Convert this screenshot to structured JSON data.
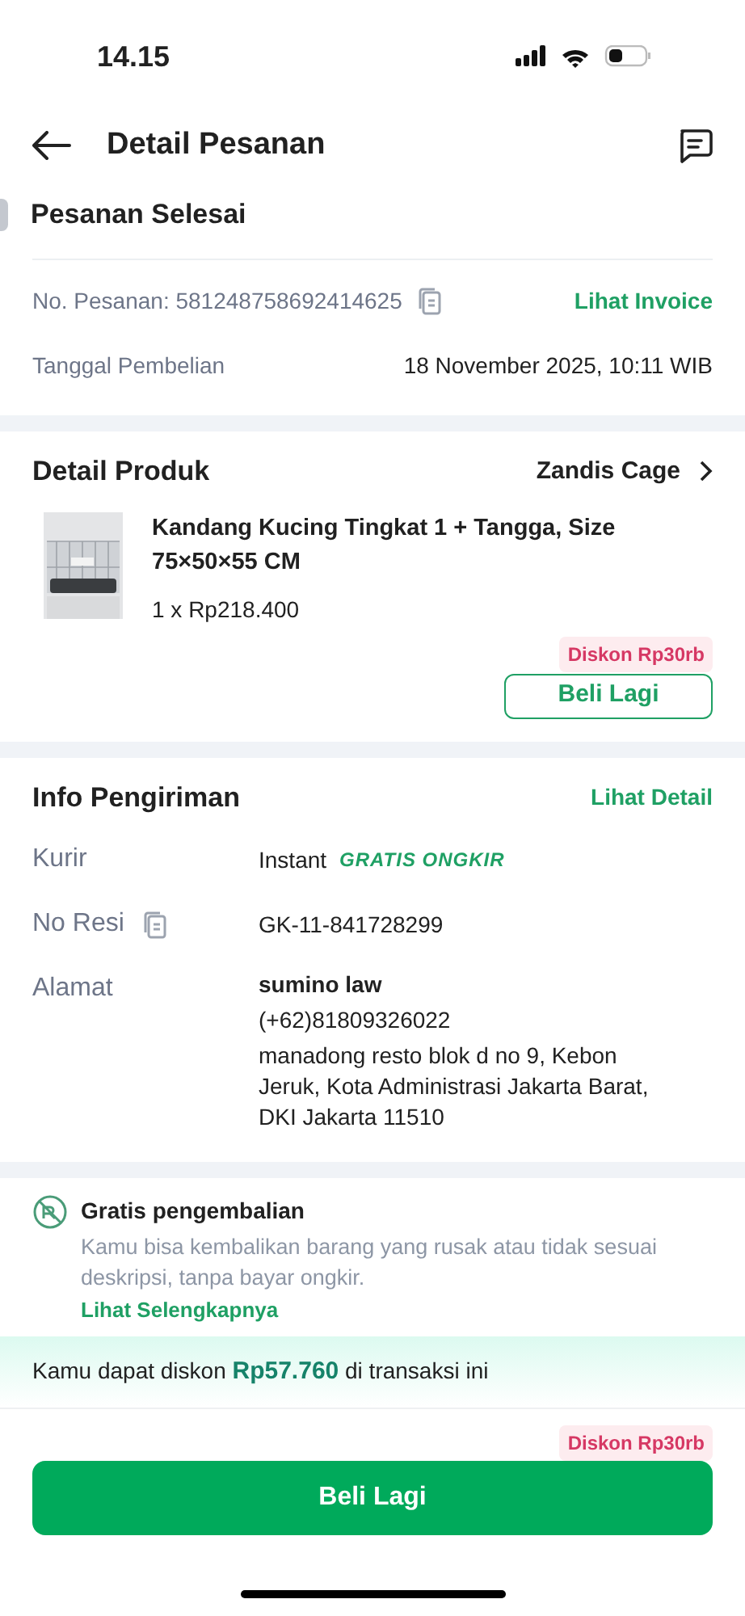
{
  "status_bar": {
    "time": "14.15"
  },
  "header": {
    "title": "Detail Pesanan"
  },
  "order": {
    "status": "Pesanan Selesai",
    "number_label": "No. Pesanan: 581248758692414625",
    "invoice_link": "Lihat Invoice",
    "date_label": "Tanggal Pembelian",
    "date_value": "18 November 2025, 10:11 WIB"
  },
  "product": {
    "section_title": "Detail Produk",
    "shop": "Zandis Cage",
    "name": "Kandang Kucing Tingkat 1 + Tangga, Size 75×50×55 CM",
    "price": "1 x Rp218.400",
    "discount_badge": "Diskon Rp30rb",
    "button": "Beli Lagi"
  },
  "shipping": {
    "section_title": "Info Pengiriman",
    "detail_link": "Lihat Detail",
    "courier_label": "Kurir",
    "courier_value": "Instant",
    "free_shipping_tag": "GRATIS ONGKIR",
    "receipt_label": "No Resi",
    "receipt_value": "GK-11-841728299",
    "address_label": "Alamat",
    "recipient": "sumino law",
    "phone": "(+62)81809326022",
    "address": "manadong resto blok d no 9, Kebon Jeruk, Kota Administrasi Jakarta Barat, DKI Jakarta 11510"
  },
  "returns": {
    "title": "Gratis pengembalian",
    "description": "Kamu bisa kembalikan barang yang rusak atau tidak sesuai deskripsi, tanpa bayar ongkir.",
    "link": "Lihat Selengkapnya"
  },
  "savings_banner": "Kamu dapat diskon **Rp57.760** di transaksi ini",
  "footer": {
    "discount_badge": "Diskon Rp30rb",
    "button": "Beli Lagi"
  }
}
